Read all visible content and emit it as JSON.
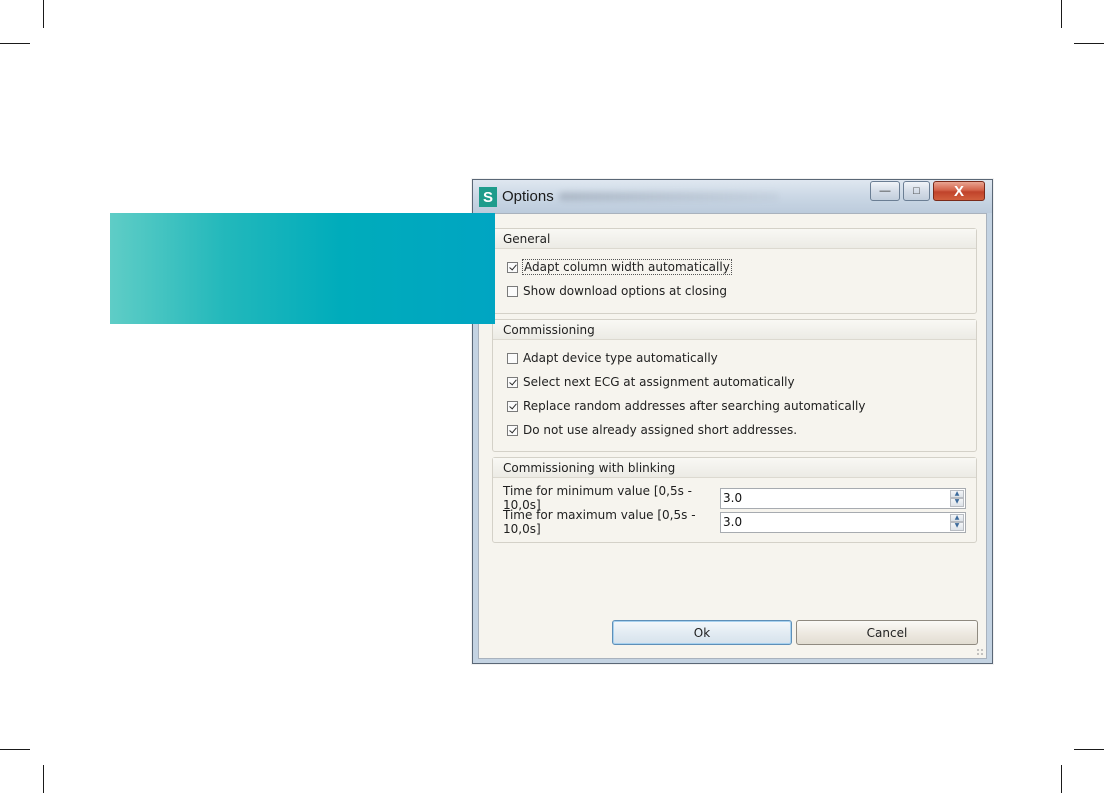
{
  "window": {
    "icon_letter": "S",
    "title": "Options",
    "minimize_glyph": "—",
    "maximize_glyph": "□",
    "close_glyph": "X"
  },
  "groups": {
    "general": {
      "title": "General",
      "options": [
        {
          "label": "Adapt column width automatically",
          "checked": true
        },
        {
          "label": "Show download options at closing",
          "checked": false
        }
      ]
    },
    "commissioning": {
      "title": "Commissioning",
      "options": [
        {
          "label": "Adapt device type automatically",
          "checked": false
        },
        {
          "label": "Select next ECG at assignment automatically",
          "checked": true
        },
        {
          "label": "Replace random addresses after searching automatically",
          "checked": true
        },
        {
          "label": "Do not use already assigned short addresses.",
          "checked": true
        }
      ]
    },
    "blinking": {
      "title": "Commissioning with blinking",
      "fields": [
        {
          "label": "Time for minimum value [0,5s - 10,0s]",
          "value": "3.0"
        },
        {
          "label": "Time for maximum value [0,5s - 10,0s]",
          "value": "3.0"
        }
      ]
    }
  },
  "buttons": {
    "ok": "Ok",
    "cancel": "Cancel"
  },
  "spin_glyphs": {
    "up": "▲",
    "down": "▼"
  },
  "colors": {
    "accent_teal": "#00acbb",
    "app_icon": "#1e9c8c",
    "close_button": "#c0432b"
  }
}
